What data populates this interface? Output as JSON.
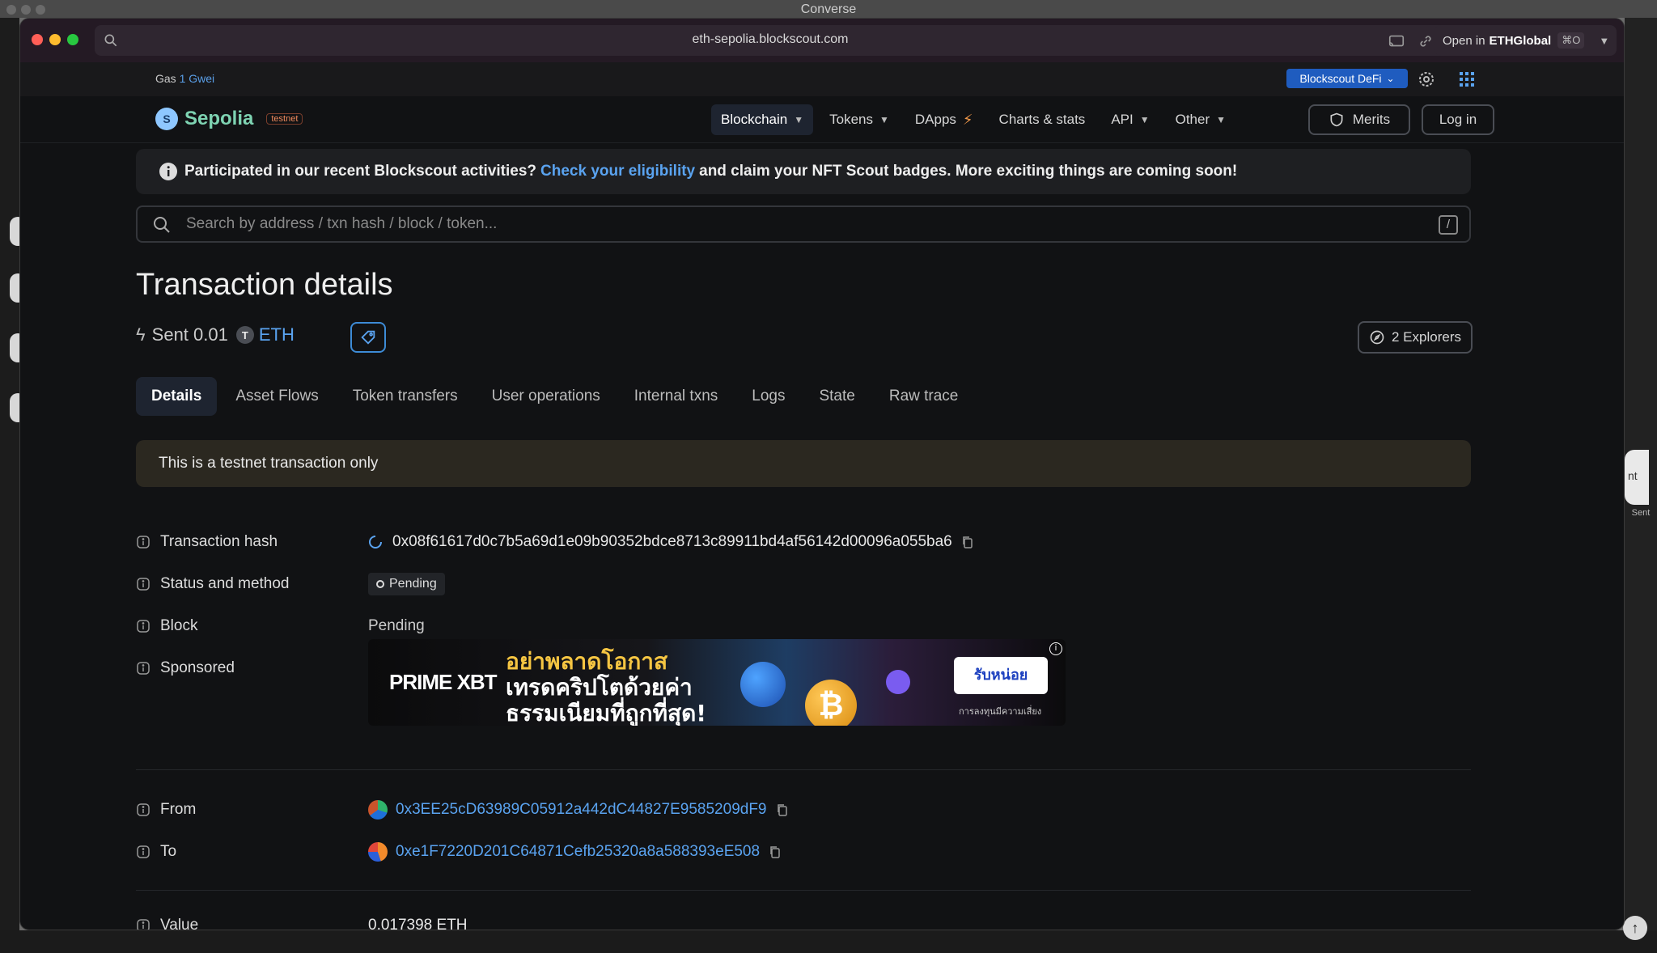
{
  "desktop": {
    "title": "Converse",
    "right_label": "Sent",
    "right_bubble_text": "nt"
  },
  "browser": {
    "url": "eth-sepolia.blockscout.com",
    "open_in_prefix": "Open in",
    "open_in_app": "ETHGlobal",
    "shortcut": "⌘O"
  },
  "topbar": {
    "gas_label": "Gas",
    "gas_value": "1 Gwei",
    "defi_label": "Blockscout DeFi"
  },
  "nav": {
    "logo": "Sepolia",
    "network_badge": "testnet",
    "items": [
      "Blockchain",
      "Tokens",
      "DApps",
      "Charts & stats",
      "API",
      "Other"
    ],
    "merits": "Merits",
    "login": "Log in"
  },
  "banner": {
    "before": "Participated in our recent Blockscout activities?",
    "link": "Check your eligibility",
    "after": "and claim your NFT Scout badges. More exciting things are coming soon!"
  },
  "search": {
    "placeholder": "Search by address / txn hash / block / token..."
  },
  "page": {
    "title": "Transaction details",
    "sent_label": "Sent 0.01",
    "token_letter": "T",
    "token": "ETH",
    "explorers": "2 Explorers"
  },
  "tabs": [
    "Details",
    "Asset Flows",
    "Token transfers",
    "User operations",
    "Internal txns",
    "Logs",
    "State",
    "Raw trace"
  ],
  "notice": "This is a testnet transaction only",
  "details": {
    "tx_hash_label": "Transaction hash",
    "tx_hash": "0x08f61617d0c7b5a69d1e09b90352bdce8713c89911bd4af56142d00096a055ba6",
    "status_label": "Status and method",
    "status": "Pending",
    "block_label": "Block",
    "block": "Pending",
    "sponsored_label": "Sponsored",
    "from_label": "From",
    "from": "0x3EE25cD63989C05912a442dC44827E9585209dF9",
    "to_label": "To",
    "to": "0xe1F7220D201C64871Cefb25320a8a588393eE508",
    "value_label": "Value",
    "value": "0.017398 ETH"
  },
  "ad": {
    "brand": "PRIME XBT",
    "line1": "อย่าพลาดโอกาส",
    "line2": "เทรดคริปโตด้วยค่า",
    "line3": "ธรรมเนียมที่ถูกที่สุด!",
    "cta": "รับหน่อย",
    "disclaimer": "การลงทุนมีความเสี่ยง",
    "coin_symbol": "₿"
  },
  "colors": {
    "accent": "#5aa3f0",
    "brand": "#7ed3b2",
    "defi": "#1f5cbf"
  }
}
